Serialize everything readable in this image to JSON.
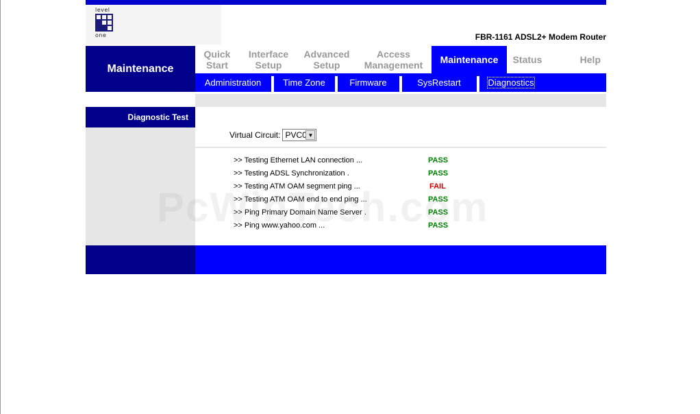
{
  "header": {
    "logo_text_top": "level",
    "logo_text_bottom": "one",
    "product": "FBR-1161 ADSL2+ Modem Router"
  },
  "sidebar": {
    "section_title": "Maintenance",
    "item_label": "Diagnostic Test"
  },
  "tabs": [
    {
      "label": "Quick\nStart",
      "active": false
    },
    {
      "label": "Interface\nSetup",
      "active": false
    },
    {
      "label": "Advanced\nSetup",
      "active": false
    },
    {
      "label": "Access\nManagement",
      "active": false
    },
    {
      "label": "Maintenance",
      "active": true
    },
    {
      "label": "Status",
      "active": false
    },
    {
      "label": "Help",
      "active": false
    }
  ],
  "subnav": [
    {
      "label": "Administration"
    },
    {
      "label": "Time Zone"
    },
    {
      "label": "Firmware"
    },
    {
      "label": "SysRestart"
    },
    {
      "label": "Diagnostics",
      "current": true
    }
  ],
  "virtual_circuit": {
    "label": "Virtual Circuit:",
    "selected": "PVC0"
  },
  "tests": [
    {
      "label": ">> Testing Ethernet LAN connection ...",
      "result": "PASS"
    },
    {
      "label": ">> Testing ADSL Synchronization .",
      "result": "PASS"
    },
    {
      "label": ">> Testing ATM OAM segment ping ...",
      "result": "FAIL"
    },
    {
      "label": ">> Testing ATM OAM end to end ping ...",
      "result": "PASS"
    },
    {
      "label": ">> Ping Primary Domain Name Server .",
      "result": "PASS"
    },
    {
      "label": ">> Ping www.yahoo.com ...",
      "result": "PASS"
    }
  ],
  "watermark": "PcWinTech.com",
  "colors": {
    "pass": "#008000",
    "fail": "#cc0000",
    "dark_blue": "#00008b",
    "bright_blue": "#0000ff"
  }
}
